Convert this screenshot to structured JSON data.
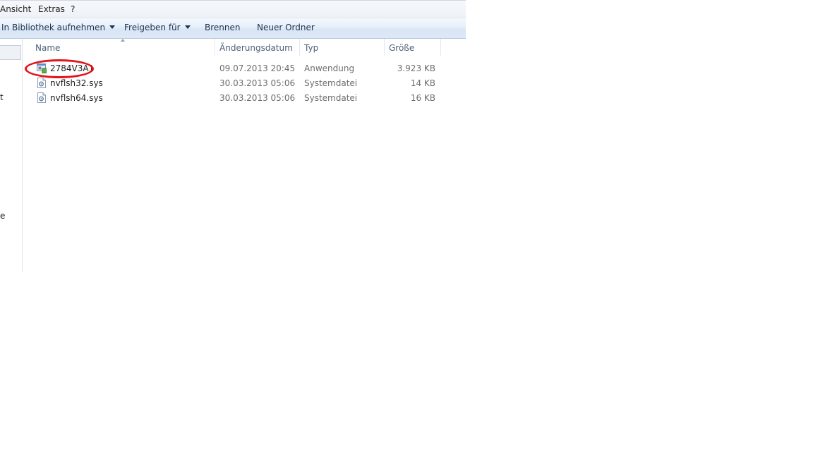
{
  "menu": {
    "items": [
      "Ansicht",
      "Extras",
      "?"
    ]
  },
  "toolbar": {
    "library_label": "In Bibliothek aufnehmen",
    "share_label": "Freigeben für",
    "burn_label": "Brennen",
    "new_folder_label": "Neuer Ordner"
  },
  "navpane": {
    "fragments": [
      "t",
      "e"
    ]
  },
  "columns": {
    "name": "Name",
    "date": "Änderungsdatum",
    "type": "Typ",
    "size": "Größe"
  },
  "files": [
    {
      "name": "2784V3A1",
      "date": "09.07.2013 20:45",
      "type": "Anwendung",
      "size": "3.923 KB",
      "icon": "application-icon"
    },
    {
      "name": "nvflsh32.sys",
      "date": "30.03.2013 05:06",
      "type": "Systemdatei",
      "size": "14 KB",
      "icon": "system-file-icon"
    },
    {
      "name": "nvflsh64.sys",
      "date": "30.03.2013 05:06",
      "type": "Systemdatei",
      "size": "16 KB",
      "icon": "system-file-icon"
    }
  ],
  "colors": {
    "highlight": "#e2161d",
    "toolbar_text": "#1e3250",
    "header_text": "#4c607a"
  }
}
